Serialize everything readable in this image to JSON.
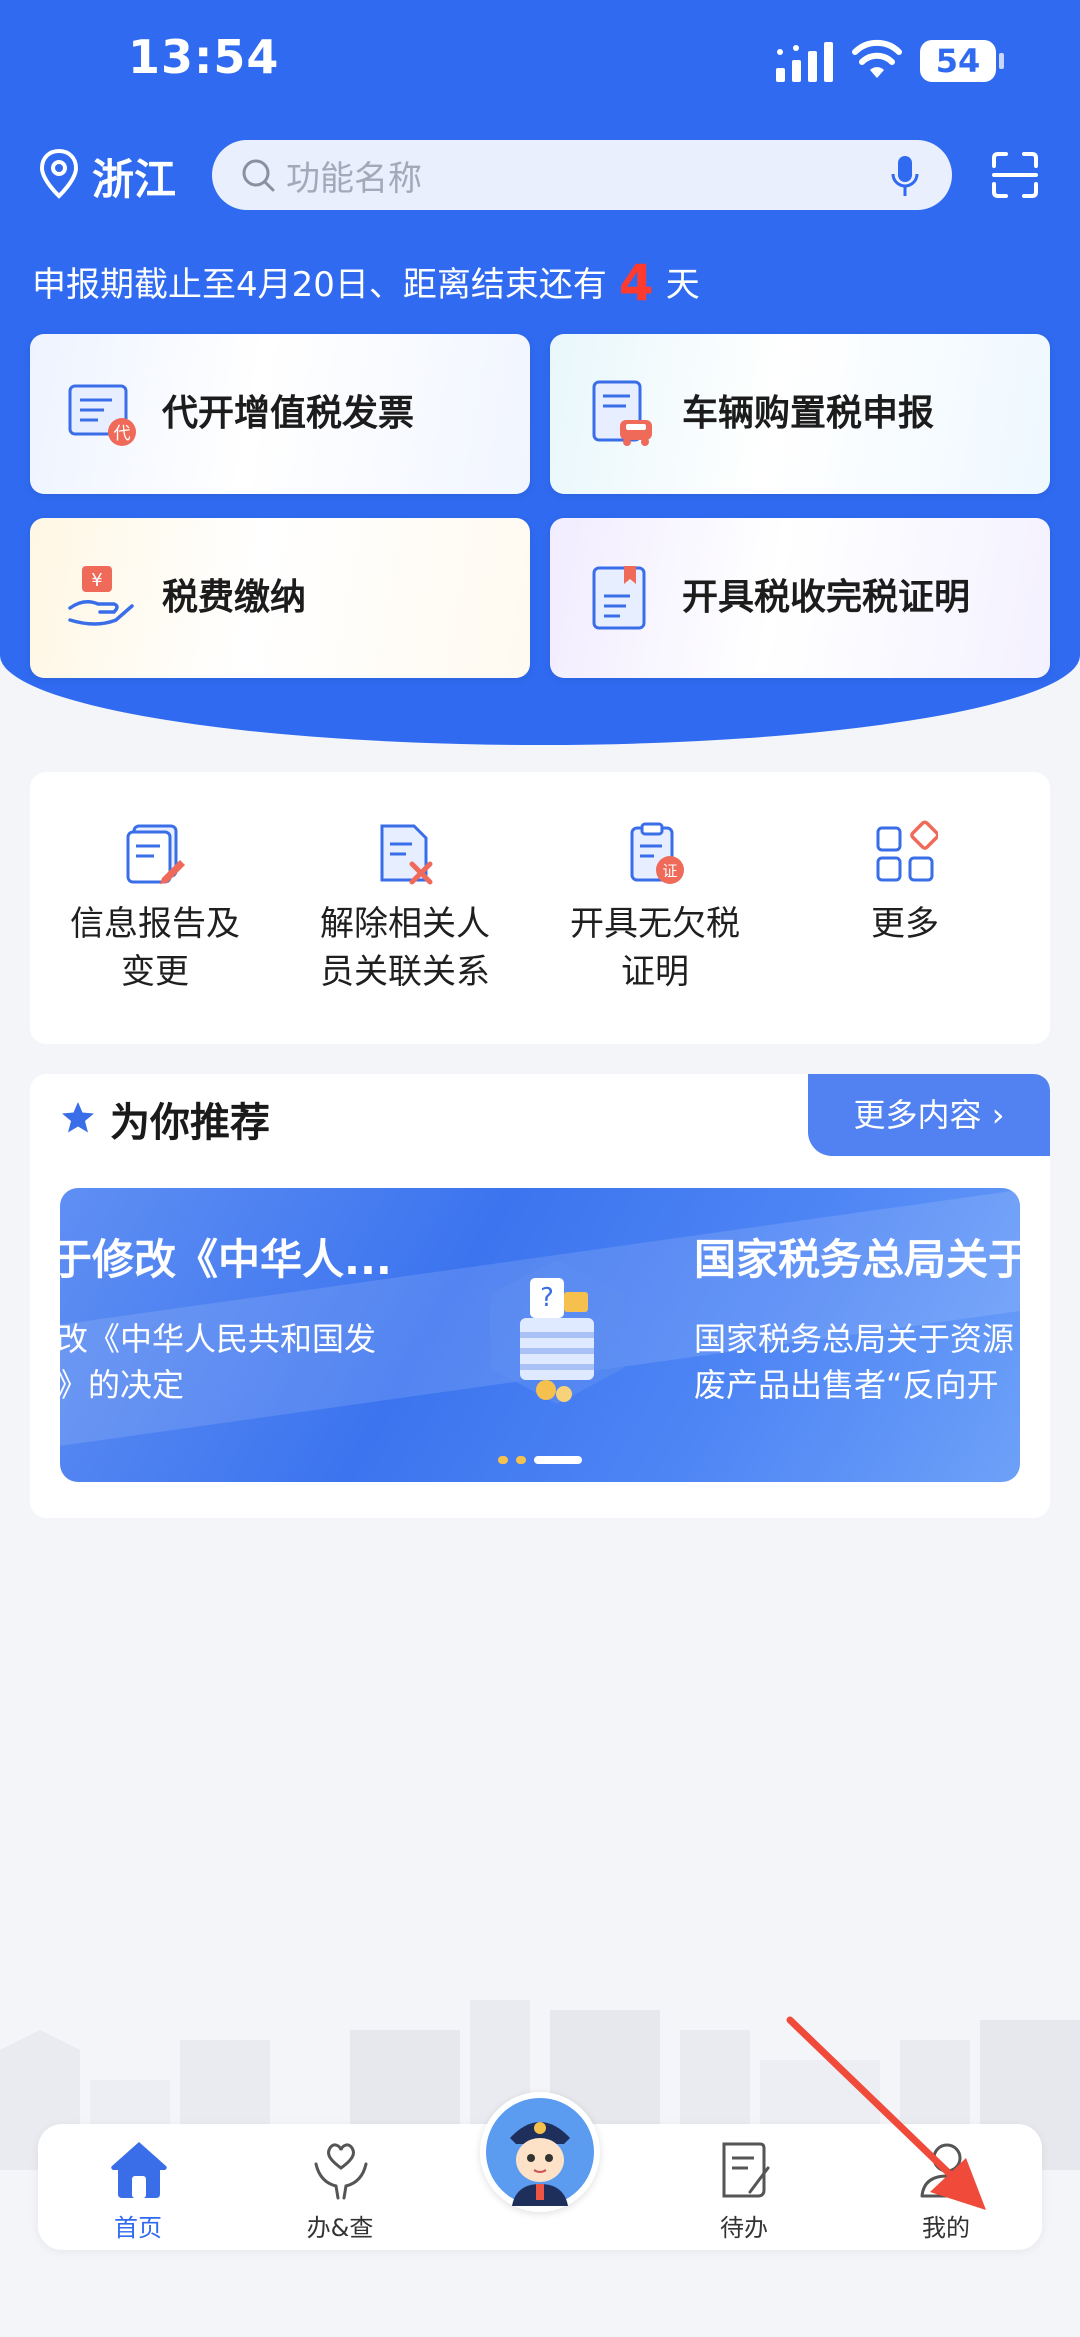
{
  "status_bar": {
    "time": "13:54",
    "battery": "54"
  },
  "header": {
    "location": "浙江",
    "search_placeholder": "功能名称",
    "deadline_prefix": "申报期截止至4月20日、距离结束还有",
    "deadline_days": "4",
    "deadline_suffix": "天"
  },
  "quick_cards": [
    {
      "label": "代开增值税发票",
      "icon": "invoice-proxy-icon"
    },
    {
      "label": "车辆购置税申报",
      "icon": "vehicle-tax-icon"
    },
    {
      "label": "税费缴纳",
      "icon": "tax-payment-icon"
    },
    {
      "label": "开具税收完税证明",
      "icon": "tax-certificate-icon"
    }
  ],
  "services": [
    {
      "line1": "信息报告及",
      "line2": "变更",
      "icon": "info-report-icon"
    },
    {
      "line1": "解除相关人",
      "line2": "员关联关系",
      "icon": "unlink-relation-icon"
    },
    {
      "line1": "开具无欠税",
      "line2": "证明",
      "icon": "no-arrears-cert-icon"
    },
    {
      "line1": "更多",
      "line2": "",
      "icon": "more-grid-icon"
    }
  ],
  "recommend": {
    "title": "为你推荐",
    "more_label": "更多内容",
    "banner": {
      "left_title": "于修改《中华人...",
      "left_sub_1": "改《中华人民共和国发",
      "left_sub_2": "》的决定",
      "right_title": "国家税务总局关于",
      "right_sub_1": "国家税务总局关于资源",
      "right_sub_2": "废产品出售者“反向开"
    }
  },
  "tabbar": {
    "home": "首页",
    "handle_query": "办&查",
    "todo": "待办",
    "mine": "我的"
  },
  "colors": {
    "primary": "#2f6af0",
    "accent_red": "#ff3b30",
    "annotation_arrow": "#f04a3a"
  }
}
